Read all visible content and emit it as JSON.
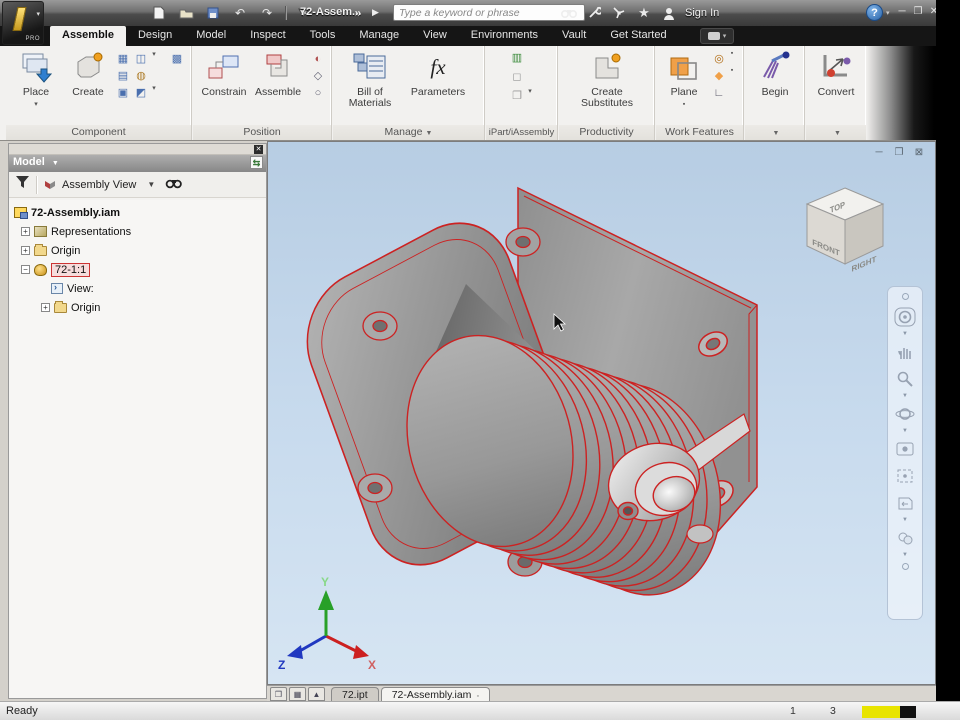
{
  "colors": {
    "selection_red": "#cc2222",
    "viewport_blue": "#c7daed",
    "accent_orange": "#f0a048"
  },
  "titlebar": {
    "app_badge": "PRO",
    "document_title": "72-Assem...",
    "search_placeholder": "Type a keyword or phrase",
    "sign_in_label": "Sign In"
  },
  "ribbon": {
    "tabs": [
      {
        "label": "Assemble"
      },
      {
        "label": "Design"
      },
      {
        "label": "Model"
      },
      {
        "label": "Inspect"
      },
      {
        "label": "Tools"
      },
      {
        "label": "Manage"
      },
      {
        "label": "View"
      },
      {
        "label": "Environments"
      },
      {
        "label": "Vault"
      },
      {
        "label": "Get Started"
      }
    ],
    "component": {
      "label": "Component",
      "place": "Place",
      "create": "Create"
    },
    "position": {
      "label": "Position",
      "constrain": "Constrain",
      "assemble": "Assemble"
    },
    "manage": {
      "label": "Manage",
      "bom": "Bill of Materials",
      "parameters": "Parameters",
      "fx": "fx"
    },
    "ipart": {
      "label": "iPart/iAssembly"
    },
    "productivity": {
      "label": "Productivity",
      "create_substitutes": "Create Substitutes"
    },
    "work_features": {
      "label": "Work Features",
      "plane": "Plane"
    },
    "begin": {
      "label": "Begin"
    },
    "convert": {
      "label": "Convert"
    }
  },
  "browser": {
    "panel_title": "Model",
    "view_mode": "Assembly View",
    "tree": [
      {
        "label": "72-Assembly.iam"
      },
      {
        "label": "Representations"
      },
      {
        "label": "Origin"
      },
      {
        "label": "72-1:1"
      },
      {
        "label": "View:"
      },
      {
        "label": "Origin"
      }
    ]
  },
  "viewport": {
    "viewcube": {
      "top": "TOP",
      "front": "FRONT",
      "right": "RIGHT"
    },
    "triad": {
      "x": "X",
      "y": "Y",
      "z": "Z"
    }
  },
  "doc_tabs": [
    {
      "label": "72.ipt"
    },
    {
      "label": "72-Assembly.iam"
    }
  ],
  "statusbar": {
    "ready": "Ready",
    "count1": "1",
    "count2": "3"
  }
}
